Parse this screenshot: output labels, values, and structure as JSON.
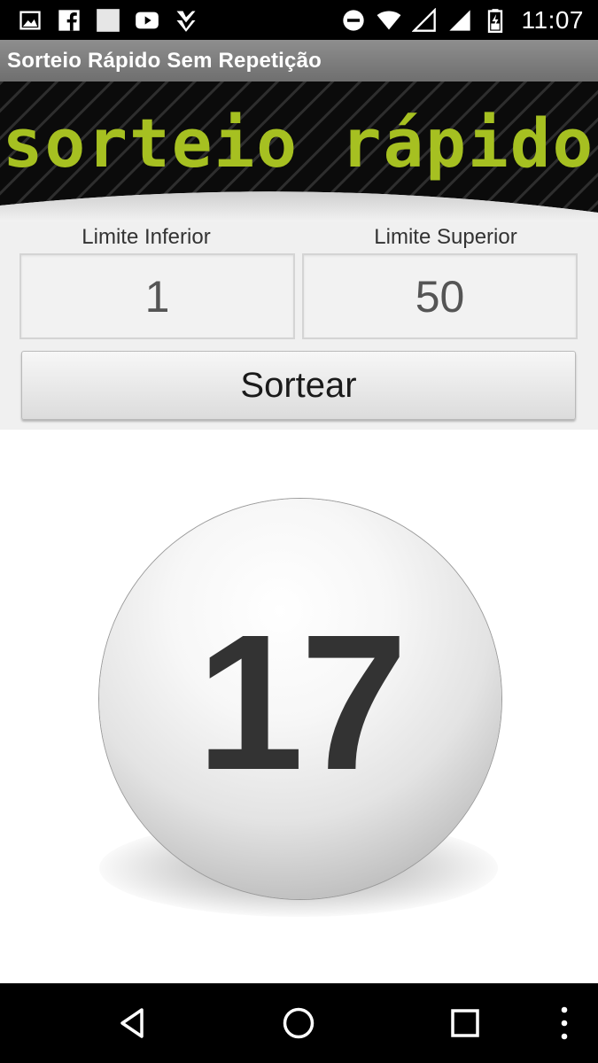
{
  "status_bar": {
    "time": "11:07",
    "left_icons": [
      "image-icon",
      "facebook-icon",
      "blank-square-icon",
      "youtube-icon",
      "check-icon"
    ],
    "right_icons": [
      "do-not-disturb-icon",
      "wifi-icon",
      "signal-empty-icon",
      "signal-icon",
      "battery-icon"
    ]
  },
  "app_title": "Sorteio Rápido Sem Repetição",
  "banner": {
    "logo_text": "sorteio rápido",
    "logo_color": "#a6c021"
  },
  "form": {
    "lower_label": "Limite Inferior",
    "upper_label": "Limite Superior",
    "lower_value": "1",
    "upper_value": "50",
    "draw_button": "Sortear"
  },
  "result": {
    "number": "17"
  },
  "nav_bar": {
    "buttons": [
      "back-icon",
      "home-icon",
      "recents-icon",
      "menu-icon"
    ]
  }
}
